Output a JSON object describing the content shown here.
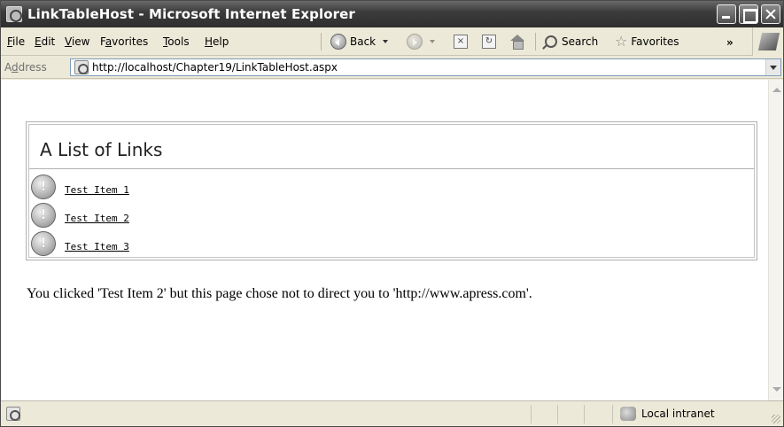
{
  "window": {
    "title": "LinkTableHost - Microsoft Internet Explorer"
  },
  "menu": [
    {
      "label": "File",
      "accel": "F",
      "rest": "ile"
    },
    {
      "label": "Edit",
      "accel": "E",
      "rest": "dit"
    },
    {
      "label": "View",
      "accel": "V",
      "rest": "iew"
    },
    {
      "label": "Favorites",
      "pre": "F",
      "accel": "a",
      "rest": "vorites"
    },
    {
      "label": "Tools",
      "accel": "T",
      "rest": "ools"
    },
    {
      "label": "Help",
      "accel": "H",
      "rest": "elp"
    }
  ],
  "toolbar": {
    "back_label": "Back",
    "search_label": "Search",
    "favorites_label": "Favorites",
    "chevron": "»"
  },
  "address": {
    "label_accel": "d",
    "label_pre": "A",
    "label_rest": "dress",
    "url": "http://localhost/Chapter19/LinkTableHost.aspx"
  },
  "link_table": {
    "title": "A List of Links",
    "items": [
      {
        "text": "Test Item 1"
      },
      {
        "text": "Test Item 2"
      },
      {
        "text": "Test Item 3"
      }
    ]
  },
  "message": "You clicked 'Test Item 2' but this page chose not to direct you to 'http://www.apress.com'.",
  "status": {
    "zone": "Local intranet"
  },
  "icons": {
    "app": "ie-page-icon",
    "back": "back-arrow-icon",
    "forward": "forward-arrow-icon",
    "stop": "stop-icon",
    "refresh": "refresh-icon",
    "home": "home-icon",
    "search": "search-icon",
    "favorites": "star-icon",
    "link_item": "warning-circle-icon",
    "zone": "intranet-icon"
  }
}
